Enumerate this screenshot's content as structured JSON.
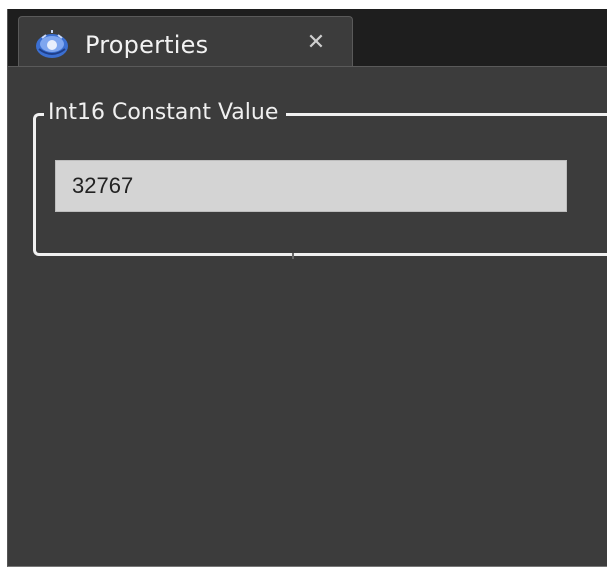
{
  "tab": {
    "title": "Properties",
    "close_glyph": "✕",
    "icon": "properties-gear-icon",
    "close_icon": "close-icon"
  },
  "group": {
    "legend": "Int16 Constant Value"
  },
  "field": {
    "value": "32767"
  },
  "colors": {
    "window_bg": "#1e1e1e",
    "panel_bg": "#3c3c3c",
    "text_light": "#f0f0f0",
    "input_bg": "#d4d4d4",
    "icon_blue": "#3b6fd1"
  }
}
